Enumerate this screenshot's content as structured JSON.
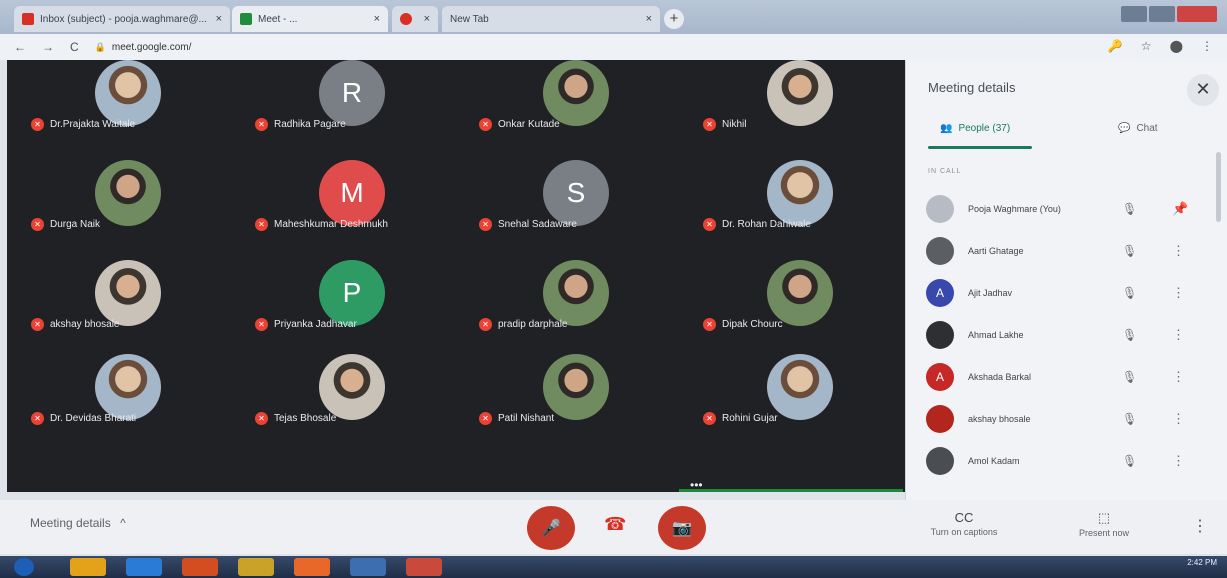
{
  "browser": {
    "tabs": [
      {
        "label": "Inbox (subject) - pooja.waghmare@...",
        "favicon_color": "#d93025"
      },
      {
        "label": "Meet - ...",
        "favicon_color": "#1e8e3e"
      },
      {
        "label": "",
        "favicon_color": "#d93025"
      },
      {
        "label": "New Tab",
        "favicon_color": "#9aa0a6"
      }
    ],
    "new_tab_symbol": "+",
    "url": "meet.google.com/",
    "nav_back": "←",
    "nav_forward": "→",
    "reload": "C",
    "lock": "🔒",
    "addr_icons": [
      "🔑",
      "☆",
      "⬤",
      "⋮"
    ]
  },
  "meeting": {
    "participants": [
      {
        "name": "Dr.Prajakta Waitale",
        "type": "photo"
      },
      {
        "name": "Radhika Pagare",
        "type": "initial",
        "initial": "R",
        "color": "#7a7f86"
      },
      {
        "name": "Onkar Kutade",
        "type": "photo2"
      },
      {
        "name": "Nikhil",
        "type": "photo3"
      },
      {
        "name": "Durga Naik",
        "type": "photo2"
      },
      {
        "name": "Maheshkumar Deshmukh",
        "type": "initial",
        "initial": "M",
        "color": "#e04b4b"
      },
      {
        "name": "Snehal Sadaware",
        "type": "initial",
        "initial": "S",
        "color": "#7a7f86"
      },
      {
        "name": "Dr. Rohan Dahiwale",
        "type": "photo"
      },
      {
        "name": "akshay bhosale",
        "type": "photo3"
      },
      {
        "name": "Priyanka Jadhavar",
        "type": "initial",
        "initial": "P",
        "color": "#2f9b64"
      },
      {
        "name": "pradip darphale",
        "type": "photo2"
      },
      {
        "name": "Dipak Chourc",
        "type": "photo2"
      },
      {
        "name": "Dr. Devidas Bharati",
        "type": "photo"
      },
      {
        "name": "Tejas Bhosale",
        "type": "photo3"
      },
      {
        "name": "Patil Nishant",
        "type": "photo2"
      },
      {
        "name": "Rohini Gujar",
        "type": "photo"
      }
    ],
    "more_label": "•••",
    "mic_off_glyph": "✕"
  },
  "panel": {
    "title": "Meeting details",
    "close_glyph": "✕",
    "people_tab": "People (37)",
    "chat_tab": "Chat",
    "in_call_label": "IN CALL",
    "people": [
      {
        "name": "Pooja Waghmare (You)",
        "avatar": "",
        "color": "#b7bcc4",
        "action": "📌"
      },
      {
        "name": "Aarti Ghatage",
        "avatar": "",
        "color": "#5b5e63",
        "action": "⋮"
      },
      {
        "name": "Ajit Jadhav",
        "avatar": "A",
        "color": "#3949ab",
        "action": "⋮"
      },
      {
        "name": "Ahmad Lakhe",
        "avatar": "",
        "color": "#2e2f33",
        "action": "⋮"
      },
      {
        "name": "Akshada Barkal",
        "avatar": "A",
        "color": "#c62828",
        "action": "⋮"
      },
      {
        "name": "akshay bhosale",
        "avatar": "",
        "color": "#b3261e",
        "action": "⋮"
      },
      {
        "name": "Amol Kadam",
        "avatar": "",
        "color": "#4a4d52",
        "action": "⋮"
      }
    ],
    "mute_glyph": "🎙"
  },
  "controls": {
    "meeting_details": "Meeting details",
    "chevron": "^",
    "mic_glyph": "🎤",
    "hangup_glyph": "☎",
    "cam_glyph": "📷",
    "captions_label": "Turn on captions",
    "captions_glyph": "CC",
    "present_label": "Present now",
    "present_glyph": "⬚",
    "more_glyph": "⋮"
  },
  "taskbar": {
    "time": "2:42 PM",
    "date": "",
    "icons": [
      "#1d5fb8",
      "#e3a21a",
      "#2a7bd6",
      "#d24d1f",
      "#c9a227",
      "#e8682a",
      "#3d6fb0",
      "#c94a3a"
    ]
  }
}
